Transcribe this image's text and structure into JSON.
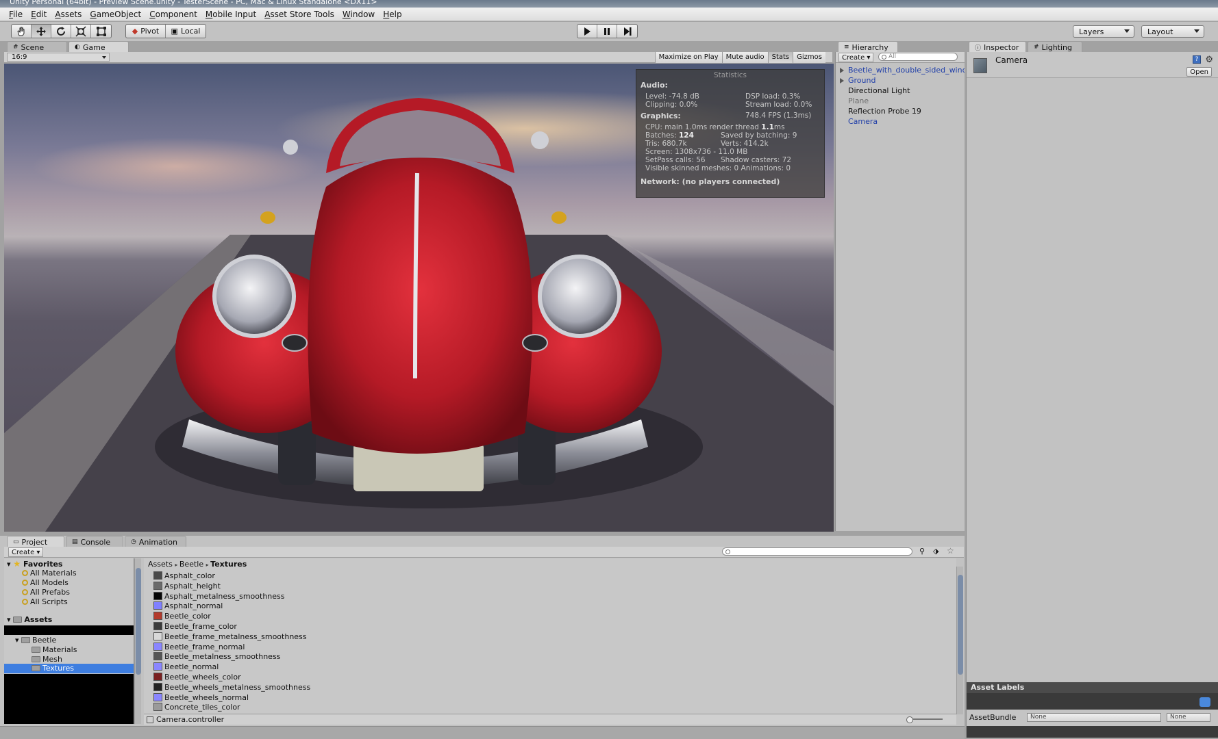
{
  "window": {
    "title": "Unity Personal (64bit) - Preview Scene.unity - TesterScene - PC, Mac & Linux Standalone <DX11>"
  },
  "menu": [
    "File",
    "Edit",
    "Assets",
    "GameObject",
    "Component",
    "Mobile Input",
    "Asset Store Tools",
    "Window",
    "Help"
  ],
  "toolbar": {
    "tools": [
      "hand-tool-icon",
      "move-tool-icon",
      "rotate-tool-icon",
      "scale-tool-icon",
      "rect-tool-icon"
    ],
    "pivot_label": "Pivot",
    "local_label": "Local",
    "play": [
      "play-icon",
      "pause-icon",
      "step-icon"
    ],
    "layers_label": "Layers",
    "layout_label": "Layout"
  },
  "view_tabs": {
    "scene": "Scene",
    "game": "Game"
  },
  "game_bar": {
    "aspect": "16:9",
    "buttons": [
      "Maximize on Play",
      "Mute audio",
      "Stats",
      "Gizmos"
    ]
  },
  "stats": {
    "title": "Statistics",
    "audio_header": "Audio:",
    "level": "Level: -74.8 dB",
    "clipping": "Clipping: 0.0%",
    "dsp_load": "DSP load: 0.3%",
    "stream_load": "Stream load: 0.0%",
    "graphics_header": "Graphics:",
    "fps": "748.4 FPS (1.3ms)",
    "cpu_prefix": "CPU: main 1.0ms  render thread",
    "cpu_value": "1.1",
    "cpu_suffix": "ms",
    "batches_prefix": "Batches:",
    "batches_value": "124",
    "saved_batching": "Saved by batching: 9",
    "tris": "Tris: 680.7k",
    "verts": "Verts: 414.2k",
    "screen": "Screen: 1308x736 - 11.0 MB",
    "setpass": "SetPass calls: 56",
    "shadow_casters": "Shadow casters: 72",
    "skinned": "Visible skinned meshes: 0  Animations: 0",
    "network": "Network: (no players connected)"
  },
  "hierarchy": {
    "tab": "Hierarchy",
    "create": "Create",
    "search_placeholder": "All",
    "items": [
      {
        "label": "Beetle_with_double_sided_windo",
        "expandable": true,
        "style": "blue"
      },
      {
        "label": "Ground",
        "expandable": true,
        "style": "blue"
      },
      {
        "label": "Directional Light",
        "expandable": false,
        "style": "normal"
      },
      {
        "label": "Plane",
        "expandable": false,
        "style": "grey"
      },
      {
        "label": "Reflection Probe 19",
        "expandable": false,
        "style": "normal"
      },
      {
        "label": "Camera",
        "expandable": false,
        "style": "blue"
      }
    ]
  },
  "inspector": {
    "tab": "Inspector",
    "lighting_tab": "Lighting",
    "object_name": "Camera",
    "open_label": "Open",
    "asset_labels": "Asset Labels",
    "asset_bundle_label": "AssetBundle",
    "bundle_value": "None",
    "variant_value": "None"
  },
  "project": {
    "tabs": [
      "Project",
      "Console",
      "Animation"
    ],
    "create": "Create",
    "favorites_label": "Favorites",
    "favorites": [
      "All Materials",
      "All Models",
      "All Prefabs",
      "All Scripts"
    ],
    "assets_label": "Assets",
    "tree": [
      {
        "label": "Beetle",
        "indent": 1
      },
      {
        "label": "Materials",
        "indent": 2
      },
      {
        "label": "Mesh",
        "indent": 2
      },
      {
        "label": "Textures",
        "indent": 2,
        "selected": true
      }
    ],
    "breadcrumb": [
      "Assets",
      "Beetle",
      "Textures"
    ],
    "files": [
      {
        "name": "Asphalt_color",
        "swatch": "#4a4a4a"
      },
      {
        "name": "Asphalt_height",
        "swatch": "#6a6a6a"
      },
      {
        "name": "Asphalt_metalness_smoothness",
        "swatch": "#050505"
      },
      {
        "name": "Asphalt_normal",
        "swatch": "#8080ff"
      },
      {
        "name": "Beetle_color",
        "swatch": "#b33a2c"
      },
      {
        "name": "Beetle_frame_color",
        "swatch": "#3a3a3a"
      },
      {
        "name": "Beetle_frame_metalness_smoothness",
        "swatch": "#d8d8d8"
      },
      {
        "name": "Beetle_frame_normal",
        "swatch": "#8a86ff"
      },
      {
        "name": "Beetle_metalness_smoothness",
        "swatch": "#555555"
      },
      {
        "name": "Beetle_normal",
        "swatch": "#8a86ff"
      },
      {
        "name": "Beetle_wheels_color",
        "swatch": "#7a2020"
      },
      {
        "name": "Beetle_wheels_metalness_smoothness",
        "swatch": "#222222"
      },
      {
        "name": "Beetle_wheels_normal",
        "swatch": "#8a86ff"
      },
      {
        "name": "Concrete_tiles_color",
        "swatch": "#9a9a9a"
      }
    ],
    "status_file": "Camera.controller"
  }
}
